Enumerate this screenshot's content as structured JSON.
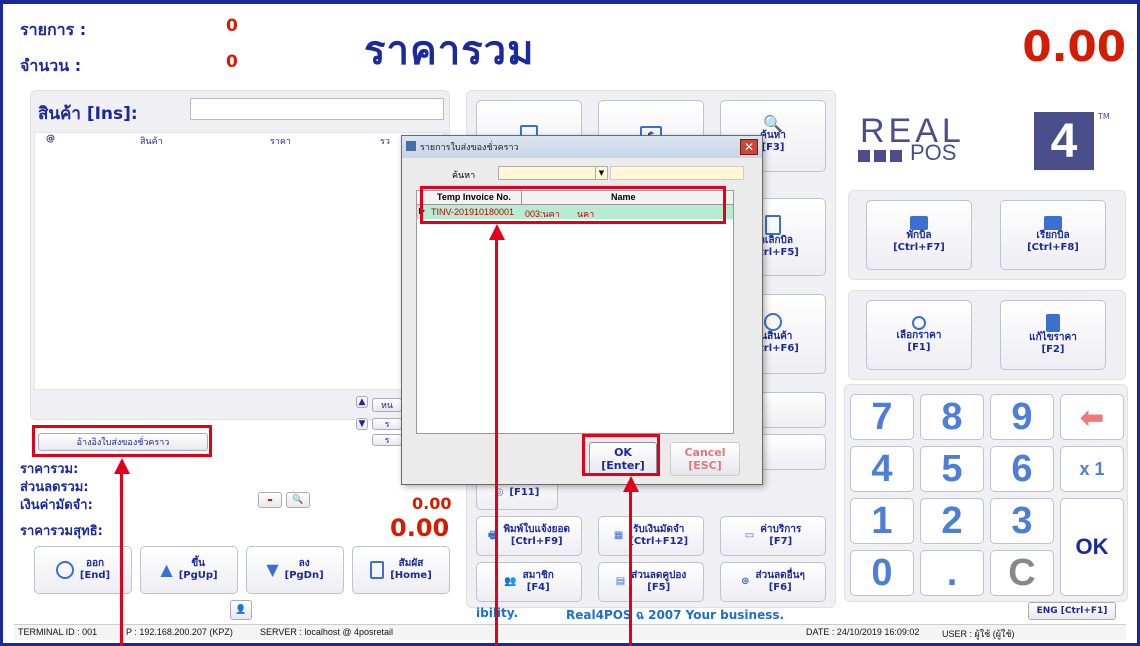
{
  "header": {
    "items_label": "รายการ :",
    "items_value": "0",
    "qty_label": "จำนวน :",
    "qty_value": "0",
    "title": "ราคารวม",
    "total": "0.00"
  },
  "product": {
    "label": "สินค้า [Ins]:",
    "columns": [
      "@",
      "สินค้า",
      "ราคา",
      "รว"
    ]
  },
  "left_summary": {
    "temp_invoice_button": "อ้างอิงใบส่งของชั่วคราว",
    "subtotal_label": "ราคารวม:",
    "discount_label": "ส่วนลดรวม:",
    "deposit_label": "เงินค่ามัดจำ:",
    "deposit_value": "0.00",
    "net_label": "ราคารวมสุทธิ:",
    "net_value": "0.00",
    "minus_btn": "-",
    "side_btns": [
      "หน",
      "ร",
      "ร"
    ]
  },
  "nav_buttons": [
    {
      "name": "exit",
      "label": "ออก",
      "key": "[End]"
    },
    {
      "name": "up",
      "label": "ขึ้น",
      "key": "[PgUp]"
    },
    {
      "name": "down",
      "label": "ลง",
      "key": "[PgDn]"
    },
    {
      "name": "touch",
      "label": "สัมผัส",
      "key": "[Home]"
    }
  ],
  "func_buttons": {
    "search": {
      "label": "ค้นหา",
      "key": "[F3]"
    },
    "cancel_bill": {
      "label": "ยกเลิกบิล",
      "key": "[Ctrl+F5]"
    },
    "return_item": {
      "label": "คืนสินค้า",
      "key": "[Ctrl+F6]"
    },
    "f11": {
      "key": "[F11]"
    },
    "print_notify": {
      "label": "พิมพ์ใบแจ้งยอด",
      "key": "[Ctrl+F9]"
    },
    "receive_deposit": {
      "label": "รับเงินมัดจำ",
      "key": "[Ctrl+F12]"
    },
    "service_fee": {
      "label": "ค่าบริการ",
      "key": "[F7]"
    },
    "member": {
      "label": "สมาชิก",
      "key": "[F4]"
    },
    "coupon": {
      "label": "ส่วนลดคูปอง",
      "key": "[F5]"
    },
    "other_discount": {
      "label": "ส่วนลดอื่นๆ",
      "key": "[F6]"
    },
    "hold_bill": {
      "label": "พักบิล",
      "key": "[Ctrl+F7]"
    },
    "recall_bill": {
      "label": "เรียกบิล",
      "key": "[Ctrl+F8]"
    },
    "choose_price": {
      "label": "เลือกราคา",
      "key": "[F1]"
    },
    "edit_price": {
      "label": "แก้ไขราคา",
      "key": "[F2]"
    }
  },
  "logo": {
    "text_top": "REAL",
    "text_bottom": "POS",
    "digit": "4",
    "tm": "TM"
  },
  "numpad": {
    "keys": [
      "7",
      "8",
      "9",
      "4",
      "5",
      "6",
      "1",
      "2",
      "3",
      "0",
      ".",
      "C"
    ],
    "times": "x 1",
    "ok": "OK"
  },
  "marquee": {
    "text1": "ibility.",
    "text2": "Real4POS ฉ 2007 Your business."
  },
  "lang_button": "ENG [Ctrl+F1]",
  "status_bar": {
    "terminal": "TERMINAL ID : 001",
    "ip": "P : 192.168.200.207 (KPZ)",
    "server": "SERVER : localhost @ 4posretail",
    "date": "DATE : 24/10/2019 16:09:02",
    "user": "USER : ผู้ใช้ (ผู้ใช้)"
  },
  "dialog": {
    "title": "รายการใบส่งของชั่วคราว",
    "search_label": "ค้นหา",
    "search_value": "",
    "columns": [
      "Temp Invoice No.",
      "Name"
    ],
    "rows": [
      {
        "invoice": "TINV-201910180001",
        "code": "003:นคา",
        "name": "นคา"
      }
    ],
    "ok_label": "OK",
    "ok_key": "[Enter]",
    "cancel_label": "Cancel",
    "cancel_key": "[ESC]"
  }
}
